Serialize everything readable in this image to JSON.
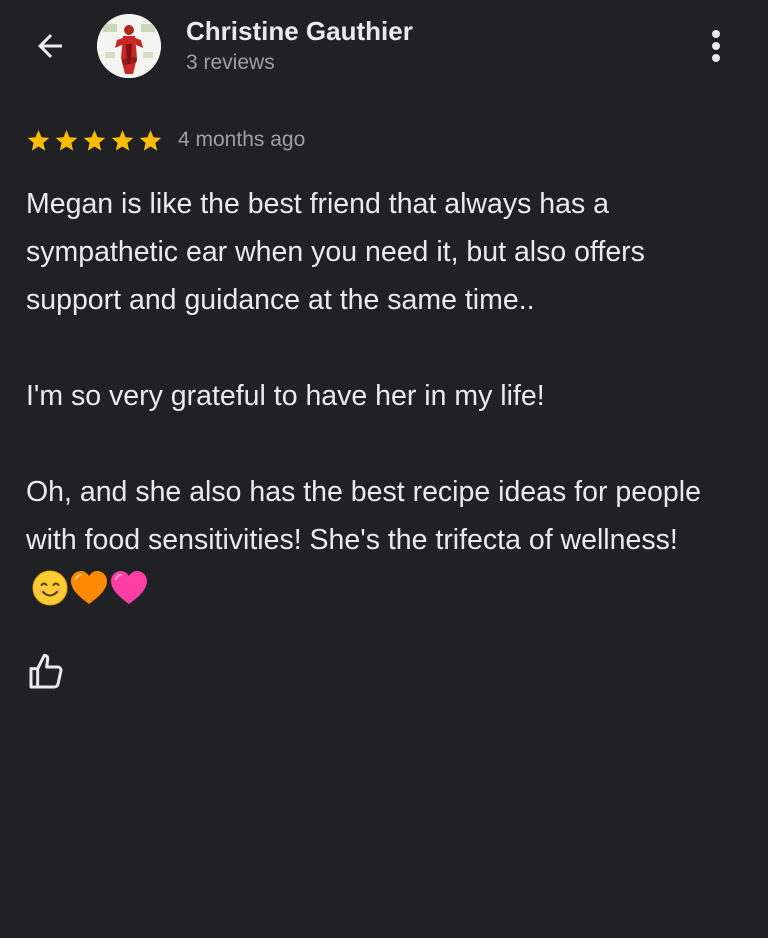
{
  "header": {
    "back_icon": "arrow-back-icon",
    "author_name": "Christine Gauthier",
    "author_reviews": "3 reviews",
    "more_icon": "more-vert-icon"
  },
  "review": {
    "rating": 5,
    "rating_max": 5,
    "star_color": "#fbbc04",
    "date": "4 months ago",
    "paragraphs": [
      "Megan is like the best friend that always has a sympathetic ear when you need it, but also offers support and guidance at the same time..",
      "I'm so very grateful to have her in my life!",
      "Oh, and she also has the best recipe ideas for people with food sensitivities! She's the trifecta of wellness!"
    ],
    "emojis": [
      "smiling-face-icon",
      "orange-heart-icon",
      "pink-heart-icon"
    ]
  },
  "actions": {
    "like_icon": "thumbs-up-icon"
  },
  "colors": {
    "background": "#202124",
    "text_primary": "#e8eaed",
    "text_secondary": "#9aa0a6"
  }
}
